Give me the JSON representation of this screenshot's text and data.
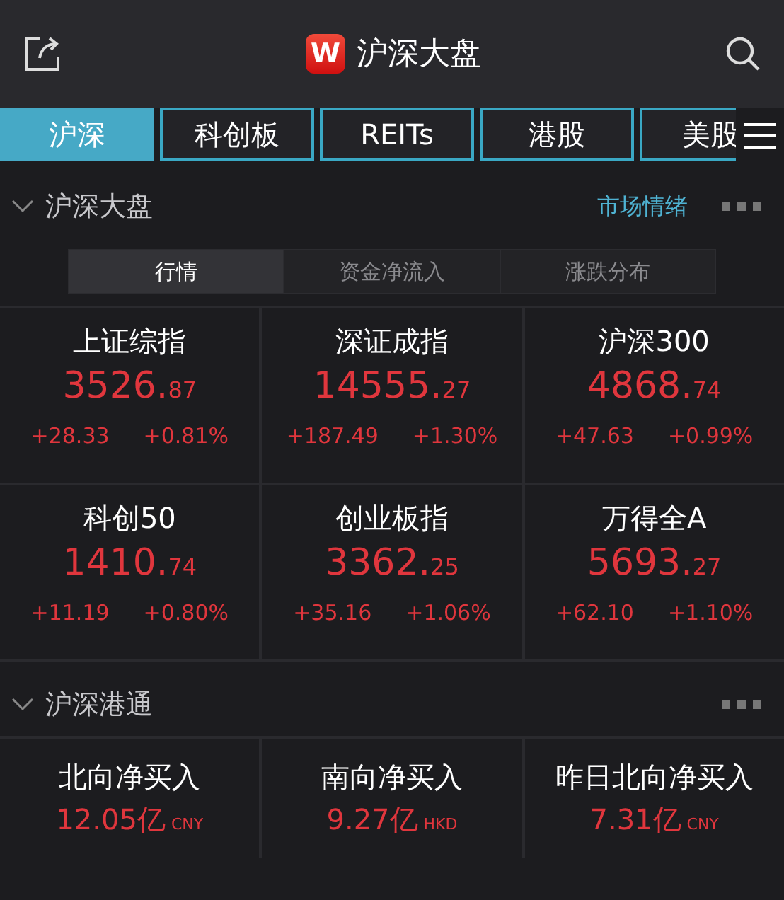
{
  "header": {
    "logo": "W",
    "title": "沪深大盘"
  },
  "tabs": [
    {
      "label": "沪深",
      "selected": true
    },
    {
      "label": "科创板",
      "selected": false
    },
    {
      "label": "REITs",
      "selected": false
    },
    {
      "label": "港股",
      "selected": false
    },
    {
      "label": "美股",
      "selected": false
    }
  ],
  "market_section": {
    "title": "沪深大盘",
    "link": "市场情绪",
    "segments": [
      {
        "label": "行情",
        "selected": true
      },
      {
        "label": "资金净流入",
        "selected": false
      },
      {
        "label": "涨跌分布",
        "selected": false
      }
    ],
    "indices": [
      {
        "name": "上证综指",
        "value_main": "3526.",
        "value_decimals": "87",
        "change": "+28.33",
        "percent": "+0.81%"
      },
      {
        "name": "深证成指",
        "value_main": "14555.",
        "value_decimals": "27",
        "change": "+187.49",
        "percent": "+1.30%"
      },
      {
        "name": "沪深300",
        "value_main": "4868.",
        "value_decimals": "74",
        "change": "+47.63",
        "percent": "+0.99%"
      },
      {
        "name": "科创50",
        "value_main": "1410.",
        "value_decimals": "74",
        "change": "+11.19",
        "percent": "+0.80%"
      },
      {
        "name": "创业板指",
        "value_main": "3362.",
        "value_decimals": "25",
        "change": "+35.16",
        "percent": "+1.06%"
      },
      {
        "name": "万得全A",
        "value_main": "5693.",
        "value_decimals": "27",
        "change": "+62.10",
        "percent": "+1.10%"
      }
    ]
  },
  "connect_section": {
    "title": "沪深港通",
    "flows": [
      {
        "name": "北向净买入",
        "amount": "12.05亿",
        "currency": "CNY"
      },
      {
        "name": "南向净买入",
        "amount": "9.27亿",
        "currency": "HKD"
      },
      {
        "name": "昨日北向净买入",
        "amount": "7.31亿",
        "currency": "CNY"
      }
    ]
  }
}
